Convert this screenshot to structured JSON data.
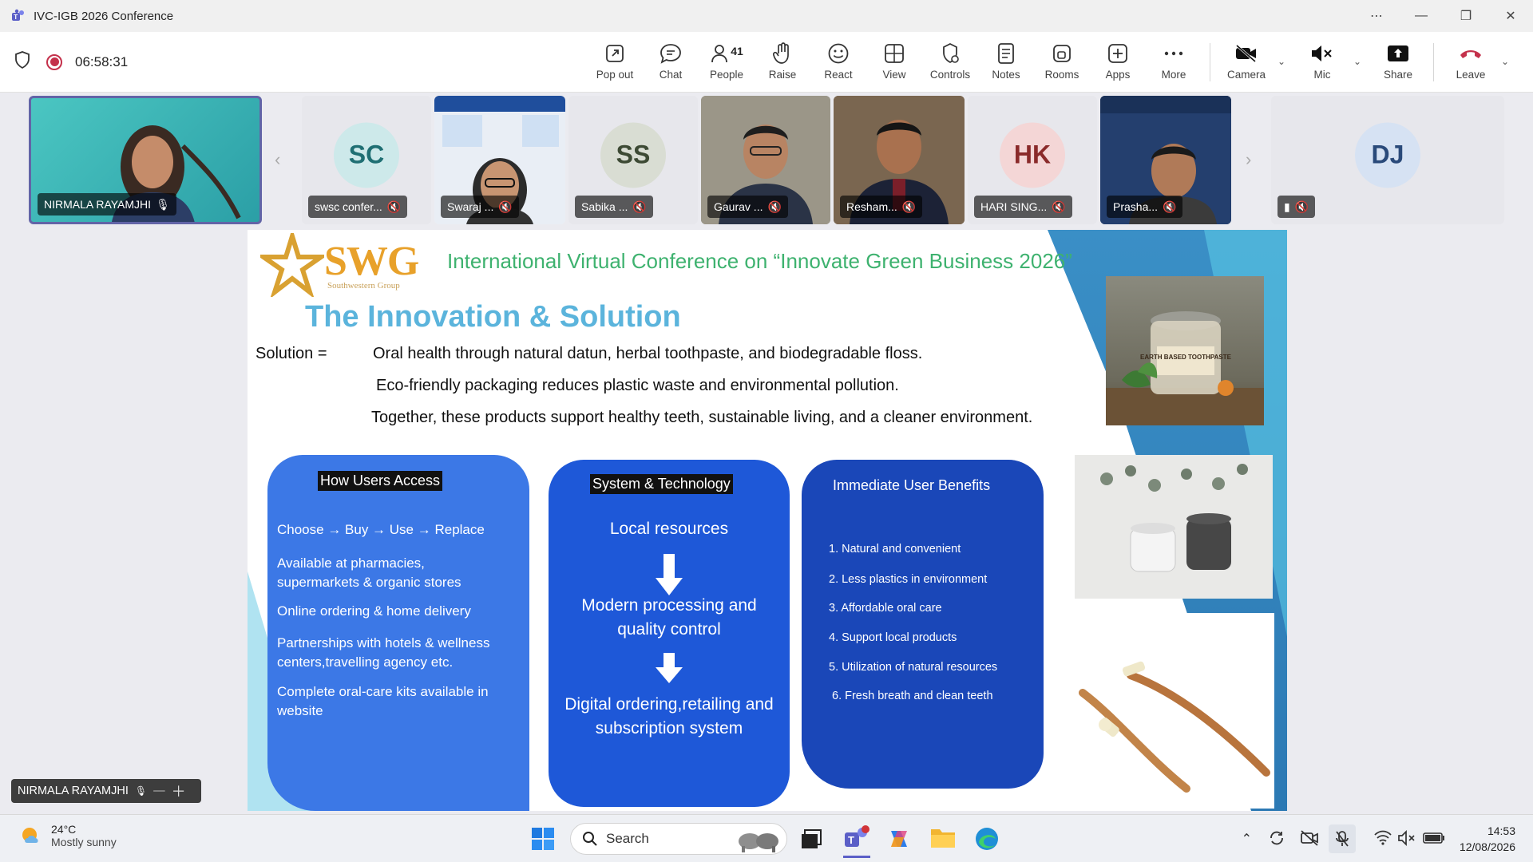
{
  "window": {
    "title": "IVC-IGB 2026 Conference",
    "controls": [
      "⋯",
      "—",
      "❐",
      "✕"
    ]
  },
  "toolbar": {
    "timer": "06:58:31",
    "buttons": [
      {
        "label": "Pop out",
        "icon": "pop-out-icon"
      },
      {
        "label": "Chat",
        "icon": "chat-icon"
      },
      {
        "label": "People",
        "icon": "people-icon",
        "badge": "41"
      },
      {
        "label": "Raise",
        "icon": "raise-hand-icon"
      },
      {
        "label": "React",
        "icon": "react-icon"
      },
      {
        "label": "View",
        "icon": "view-icon"
      },
      {
        "label": "Controls",
        "icon": "controls-icon"
      },
      {
        "label": "Notes",
        "icon": "notes-icon"
      },
      {
        "label": "Rooms",
        "icon": "rooms-icon"
      },
      {
        "label": "Apps",
        "icon": "apps-icon"
      },
      {
        "label": "More",
        "icon": "more-icon"
      },
      {
        "label": "Camera",
        "icon": "camera-off-icon"
      },
      {
        "label": "Mic",
        "icon": "mic-muted-icon"
      },
      {
        "label": "Share",
        "icon": "share-icon"
      },
      {
        "label": "Leave",
        "icon": "leave-phone-icon"
      }
    ],
    "accent_leave": "#c4314b"
  },
  "participants": [
    {
      "name": "NIRMALA RAYAMJHI",
      "type": "video"
    },
    {
      "initials": "SC",
      "name": "swsc confer...",
      "type": "avatar"
    },
    {
      "name": "Swaraj ...",
      "type": "video"
    },
    {
      "initials": "SS",
      "name": "Sabika ...",
      "type": "avatar"
    },
    {
      "name": "Gaurav ...",
      "type": "video"
    },
    {
      "name": "Resham...",
      "type": "video"
    },
    {
      "initials": "HK",
      "name": "HARI SING...",
      "type": "avatar"
    },
    {
      "name": "Prasha...",
      "type": "video"
    },
    {
      "initials": "DJ",
      "name": "",
      "type": "avatar"
    }
  ],
  "slide": {
    "logo_text": "SWG",
    "logo_sub": "Southwestern Group",
    "conference_title": "International Virtual Conference on “Innovate Green Business 2026”",
    "heading": "The Innovation & Solution",
    "solution_label": "Solution =",
    "solution_lines": [
      "Oral health through natural datun, herbal toothpaste, and biodegradable floss.",
      "Eco-friendly packaging reduces plastic waste and environmental pollution.",
      "Together, these products support healthy teeth, sustainable living, and a  cleaner  environment."
    ],
    "access": {
      "title": "How Users Access",
      "items": [
        "Choose → Buy → Use → Replace",
        "Available at pharmacies, supermarkets & organic stores",
        "Online ordering & home delivery",
        "Partnerships with hotels & wellness centers,travelling agency etc.",
        "Complete oral-care kits available in website"
      ]
    },
    "tech": {
      "title": "System & Technology",
      "steps": [
        "Local resources",
        "Modern processing and quality control",
        "Digital ordering,retailing and subscription system"
      ]
    },
    "benefits": {
      "title": "Immediate User Benefits",
      "items": [
        "1. Natural and convenient",
        "2. Less plastics in environment",
        "3. Affordable oral care",
        "4. Support local products",
        "5. Utilization of natural resources",
        "6. Fresh breath and  clean teeth"
      ]
    },
    "jar_label": "EARTH BASED TOOTHPASTE",
    "colors": {
      "access_card": "#3c78e6",
      "tech_card": "#1e58d8",
      "benefits_card": "#1a47b8",
      "conference_title": "#3eb26f",
      "heading": "#5bb4dc"
    }
  },
  "selfview": {
    "name": "NIRMALA RAYAMJHI"
  },
  "taskbar": {
    "weather_temp": "24°C",
    "weather_cond": "Mostly sunny",
    "search_placeholder": "Search",
    "time": "14:53",
    "date": "12/08/2026"
  }
}
